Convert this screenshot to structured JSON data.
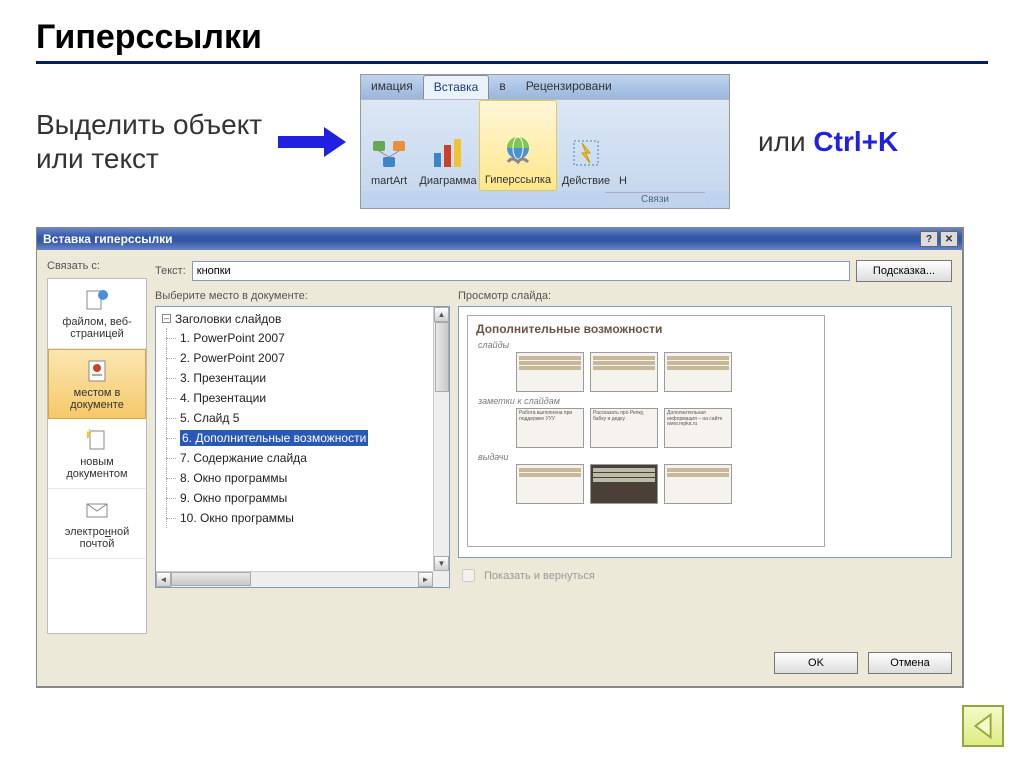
{
  "page": {
    "title": "Гиперссылки",
    "intro": "Выделить объект или текст",
    "or_text": "или ",
    "shortcut": "Ctrl+K"
  },
  "ribbon": {
    "tabs": [
      "имация",
      "Вставка",
      "в",
      "Рецензировани"
    ],
    "items": {
      "smartart": "martArt",
      "chart": "Диаграмма",
      "hyperlink": "Гиперссылка",
      "action": "Действие",
      "next": "Н"
    },
    "group_label": "Связи"
  },
  "dialog": {
    "title": "Вставка гиперссылки",
    "link_to_label": "Связать с:",
    "text_label": "Текст:",
    "text_value": "кнопки",
    "hint_button": "Подсказка...",
    "sidebar": {
      "file_web": "файлом, веб-страницей",
      "place_doc": "местом в документе",
      "new_doc": "новым документом",
      "email": "электронной почтой"
    },
    "tree_label": "Выберите место в документе:",
    "tree_root": "Заголовки слайдов",
    "tree_items": [
      "1. PowerPoint 2007",
      "2. PowerPoint 2007",
      "3. Презентации",
      "4. Презентации",
      "5. Слайд 5",
      "6. Дополнительные возможности",
      "7. Содержание слайда",
      "8. Окно программы",
      "9. Окно программы",
      "10. Окно программы"
    ],
    "preview_label": "Просмотр слайда:",
    "preview": {
      "title": "Дополнительные возможности",
      "section1": "слайды",
      "section2": "заметки к слайдам",
      "section3": "выдачи",
      "note_a": "Работа выполнена при поддержке УУУ",
      "note_b": "Рассказать про Репку, бабку и дедку",
      "note_c": "Дополнительная информация – на сайте www.repka.ru"
    },
    "show_return": "Показать и вернуться",
    "ok": "OK",
    "cancel": "Отмена"
  }
}
